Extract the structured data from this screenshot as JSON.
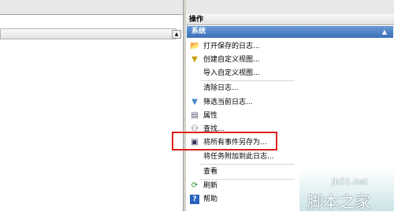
{
  "pane_title": "操作",
  "section": {
    "label": "系统",
    "chevron": "▲"
  },
  "left": {
    "scroll_up": "▲"
  },
  "actions": [
    {
      "name": "open-saved-log",
      "icon": "folder-open-icon",
      "glyph": "📂",
      "label": "打开保存的日志..."
    },
    {
      "name": "create-custom-view",
      "icon": "funnel-star-icon",
      "glyph": "▼",
      "label": "创建自定义视图..."
    },
    {
      "name": "import-custom-view",
      "icon": "",
      "glyph": "",
      "label": "导入自定义视图..."
    },
    {
      "name": "clear-log",
      "icon": "",
      "glyph": "",
      "label": "清除日志..."
    },
    {
      "name": "filter-current-log",
      "icon": "funnel-icon",
      "glyph": "▼",
      "label": "筛选当前日志..."
    },
    {
      "name": "properties",
      "icon": "properties-icon",
      "glyph": "▤",
      "label": "属性"
    },
    {
      "name": "find",
      "icon": "binoculars-icon",
      "glyph": "⚇",
      "label": "查找..."
    },
    {
      "name": "save-all-events-as",
      "icon": "save-disk-icon",
      "glyph": "▣",
      "label": "将所有事件另存为..."
    },
    {
      "name": "attach-task-to-log",
      "icon": "",
      "glyph": "",
      "label": "将任务附加到此日志..."
    },
    {
      "name": "view",
      "icon": "",
      "glyph": "",
      "label": "查看"
    },
    {
      "name": "refresh",
      "icon": "refresh-icon",
      "glyph": "⟳",
      "label": "刷新"
    },
    {
      "name": "help",
      "icon": "help-icon",
      "glyph": "?",
      "label": "帮助"
    }
  ],
  "watermark": {
    "site": "jb51.net",
    "brand": "脚本之家"
  },
  "colors": {
    "section_bg": "#3c6fb8",
    "highlight": "#e02020"
  }
}
